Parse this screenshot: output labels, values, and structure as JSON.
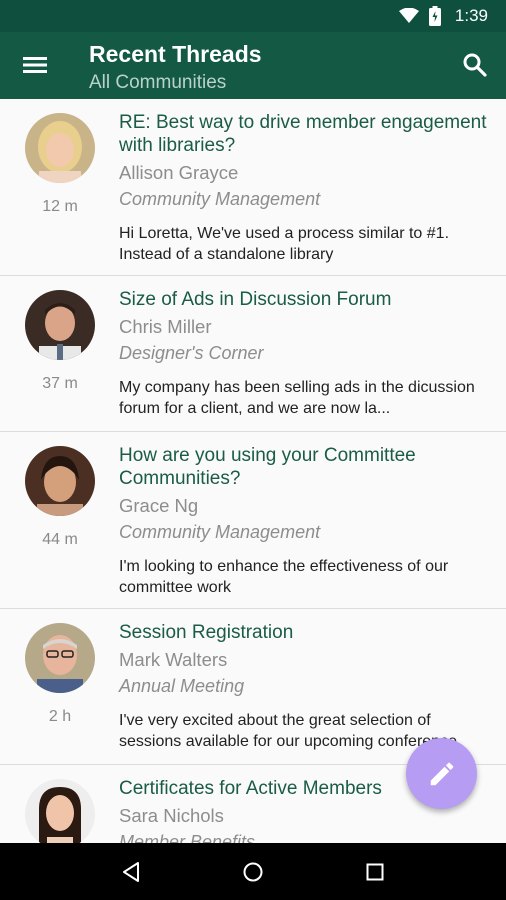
{
  "status": {
    "time": "1:39",
    "icons": [
      "wifi-icon",
      "battery-icon"
    ]
  },
  "appbar": {
    "title": "Recent Threads",
    "subtitle": "All Communities",
    "menu_icon": "menu-icon",
    "search_icon": "search-icon"
  },
  "colors": {
    "appbar": "#135944",
    "statusbar": "#0f4f3d",
    "subject": "#1a5c46",
    "fab": "#b69cf2"
  },
  "threads": [
    {
      "subject": "RE: Best way to drive member engagement with libraries?",
      "author": "Allison Grayce",
      "community": "Community Management",
      "snippet": "Hi Loretta, We've used a process similar to #1. Instead of a standalone library",
      "ago": "12 m"
    },
    {
      "subject": "Size of Ads in Discussion Forum",
      "author": "Chris Miller",
      "community": "Designer's Corner",
      "snippet": "My company has been selling ads in the dicussion forum for a client, and we are now la...",
      "ago": "37 m"
    },
    {
      "subject": "How are you using your Committee Communities?",
      "author": "Grace Ng",
      "community": "Community Management",
      "snippet": "I'm looking to enhance the effectiveness of our committee work",
      "ago": "44 m"
    },
    {
      "subject": "Session Registration",
      "author": "Mark Walters",
      "community": "Annual Meeting",
      "snippet": "I've very excited about the great selection of sessions available for our upcoming conference",
      "ago": "2 h"
    },
    {
      "subject": "Certificates for Active Members",
      "author": "Sara Nichols",
      "community": "Member Benefits",
      "snippet": "",
      "ago": ""
    }
  ],
  "fab": {
    "icon": "pencil-icon"
  },
  "navbar": {
    "icons": [
      "back-icon",
      "home-icon",
      "recents-icon"
    ]
  }
}
